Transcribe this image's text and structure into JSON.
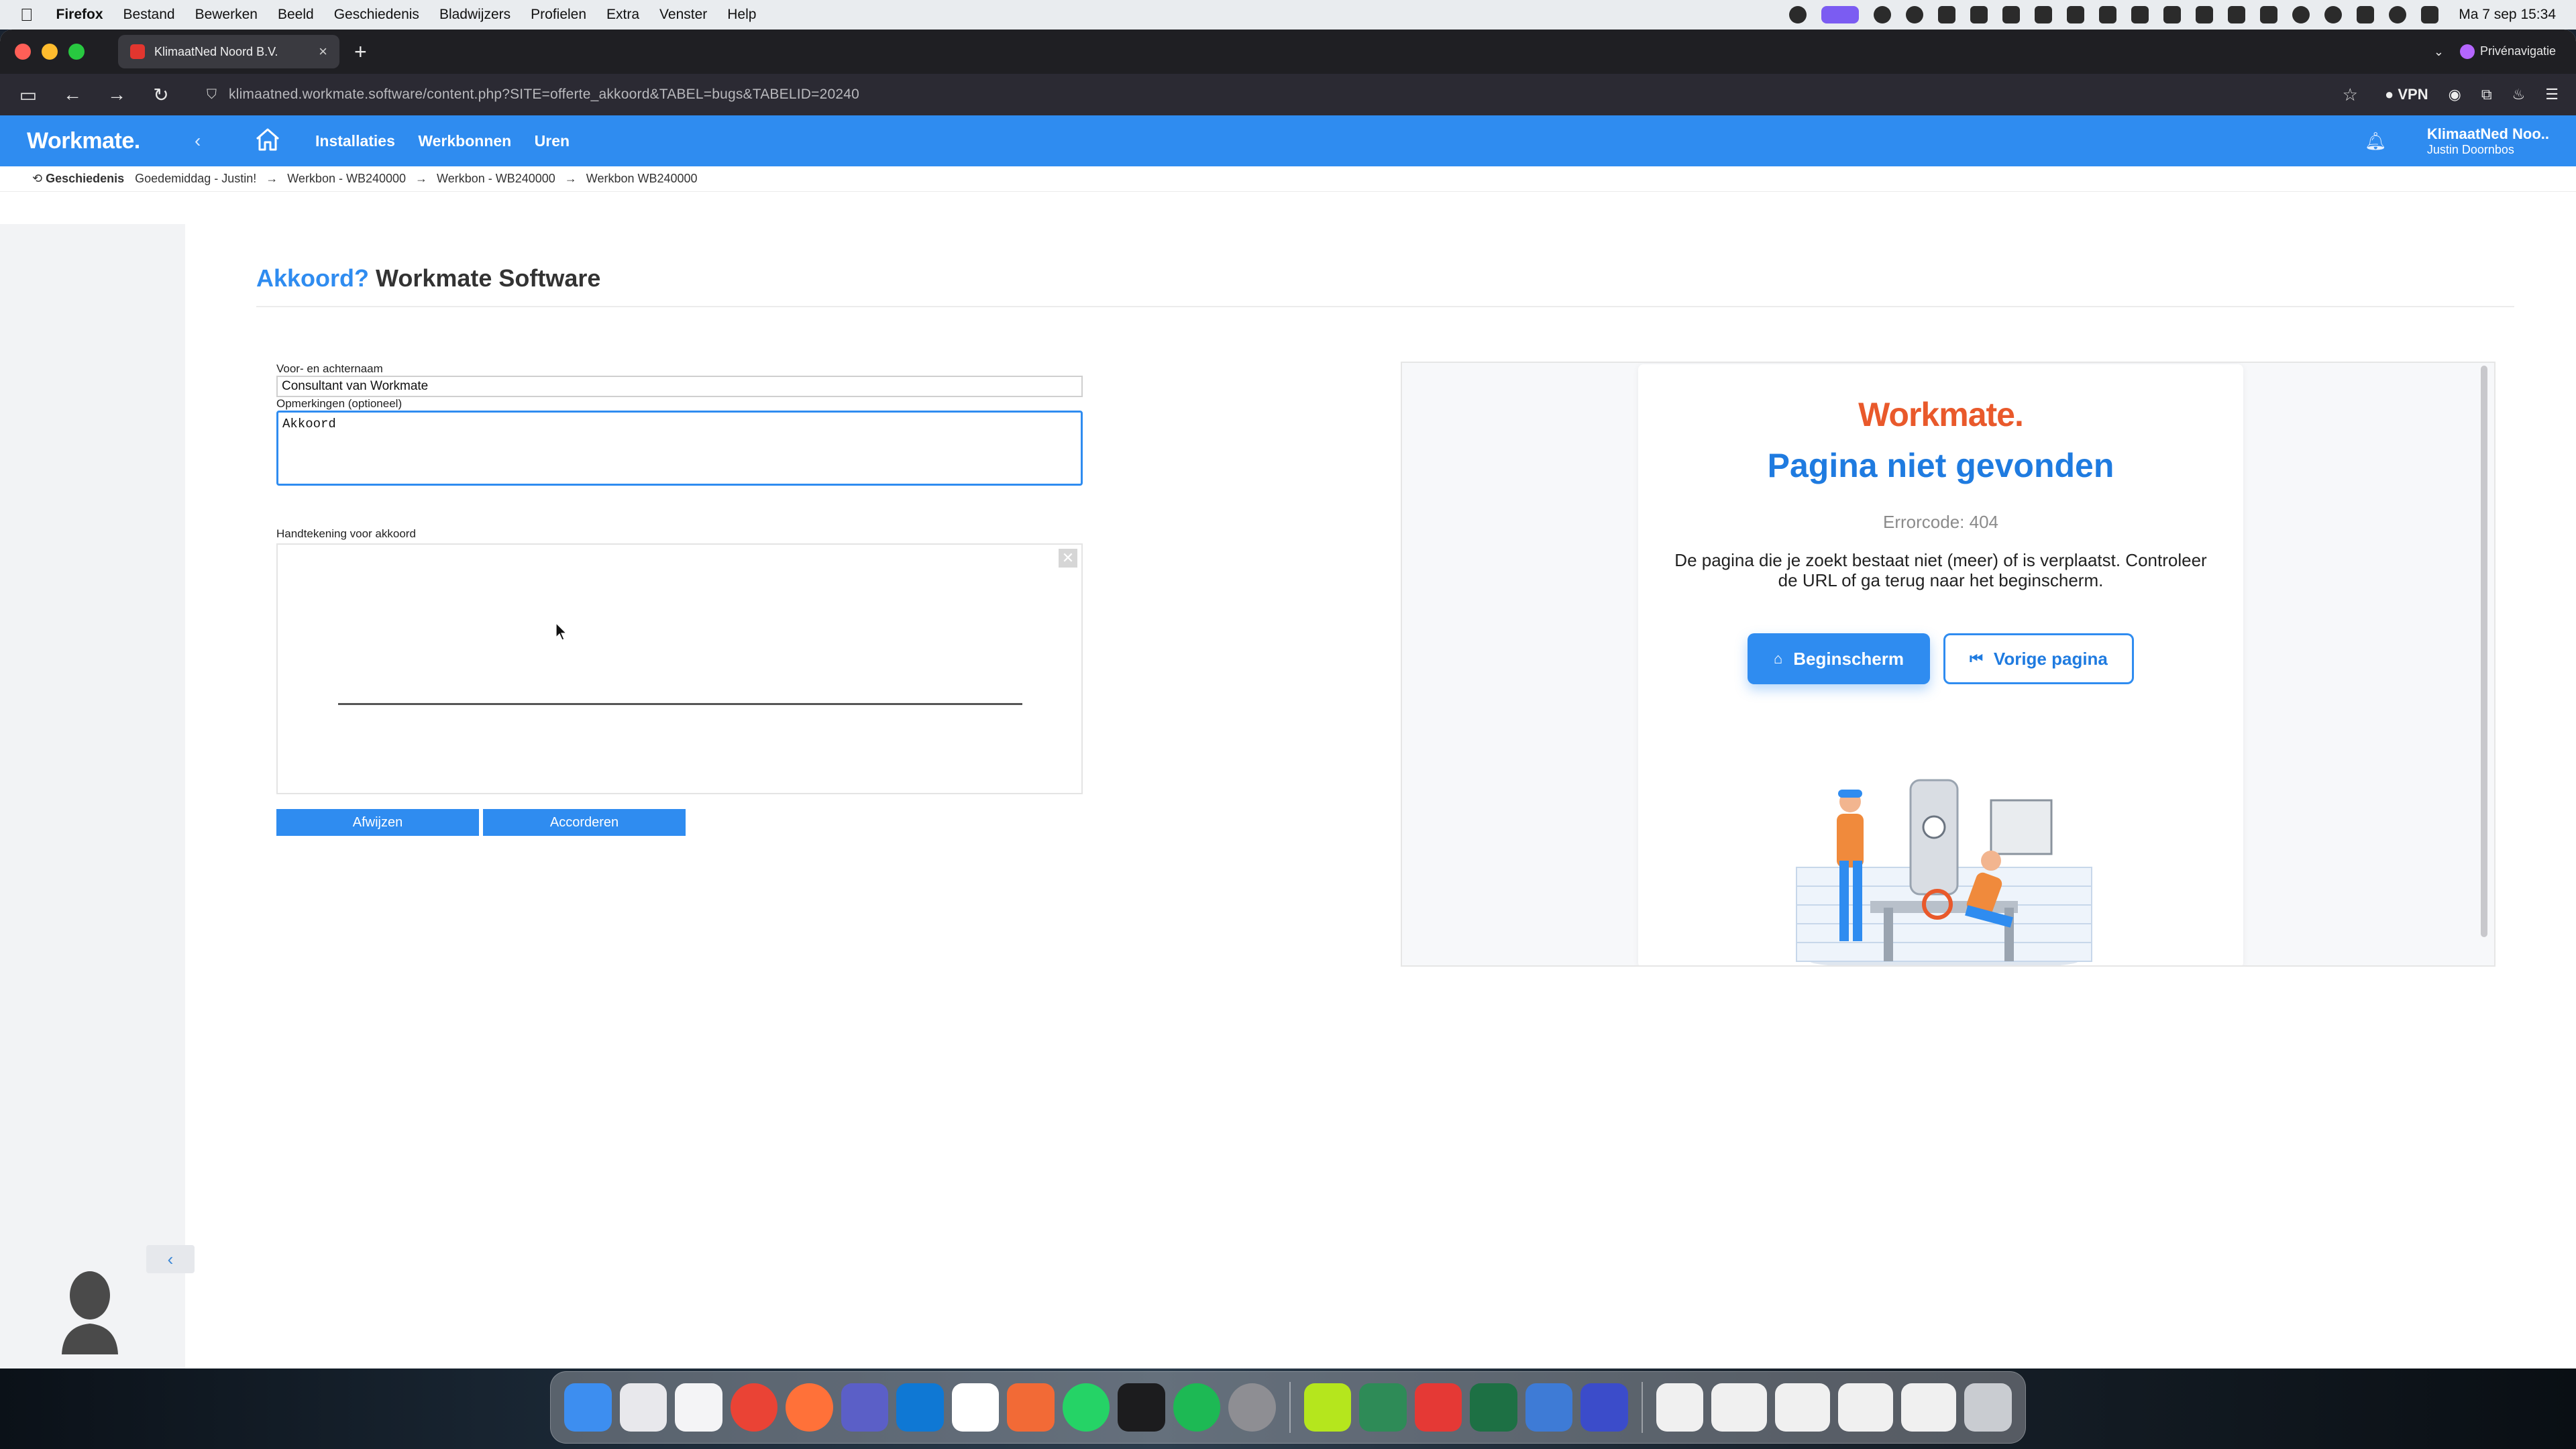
{
  "menubar": {
    "app": "Firefox",
    "items": [
      "Bestand",
      "Bewerken",
      "Beeld",
      "Geschiedenis",
      "Bladwijzers",
      "Profielen",
      "Extra",
      "Venster",
      "Help"
    ],
    "clock": "Ma 7 sep  15:34"
  },
  "browser": {
    "tab_title": "KlimaatNed Noord B.V.",
    "private_label": "Privénavigatie",
    "url": "klimaatned.workmate.software/content.php?SITE=offerte_akkoord&TABEL=bugs&TABELID=20240",
    "vpn_label": "VPN"
  },
  "app": {
    "logo": "Workmate.",
    "nav": [
      "Installaties",
      "Werkbonnen",
      "Uren"
    ],
    "org": "KlimaatNed Noo..",
    "user": "Justin Doornbos"
  },
  "breadcrumb": {
    "history_label": "Geschiedenis",
    "items": [
      "Goedemiddag - Justin!",
      "Werkbon - WB240000",
      "Werkbon - WB240000",
      "Werkbon WB240000"
    ],
    "separator": "→"
  },
  "page": {
    "title_accent": "Akkoord?",
    "title_rest": "Workmate Software"
  },
  "form": {
    "name_label": "Voor- en achternaam",
    "name_value": "Consultant van Workmate",
    "notes_label": "Opmerkingen (optioneel)",
    "notes_value": "Akkoord",
    "signature_label": "Handtekening voor akkoord",
    "reject_label": "Afwijzen",
    "accept_label": "Accorderen"
  },
  "embed": {
    "logo": "Workmate.",
    "title": "Pagina niet gevonden",
    "code": "Errorcode: 404",
    "text": "De pagina die je zoekt bestaat niet (meer) of is verplaatst. Controleer de URL of ga terug naar het beginscherm.",
    "home_button": "Beginscherm",
    "back_button": "Vorige pagina"
  },
  "colors": {
    "brand_blue": "#2f8cf0",
    "brand_orange": "#e9592b",
    "title_blue": "#1f7be0"
  }
}
